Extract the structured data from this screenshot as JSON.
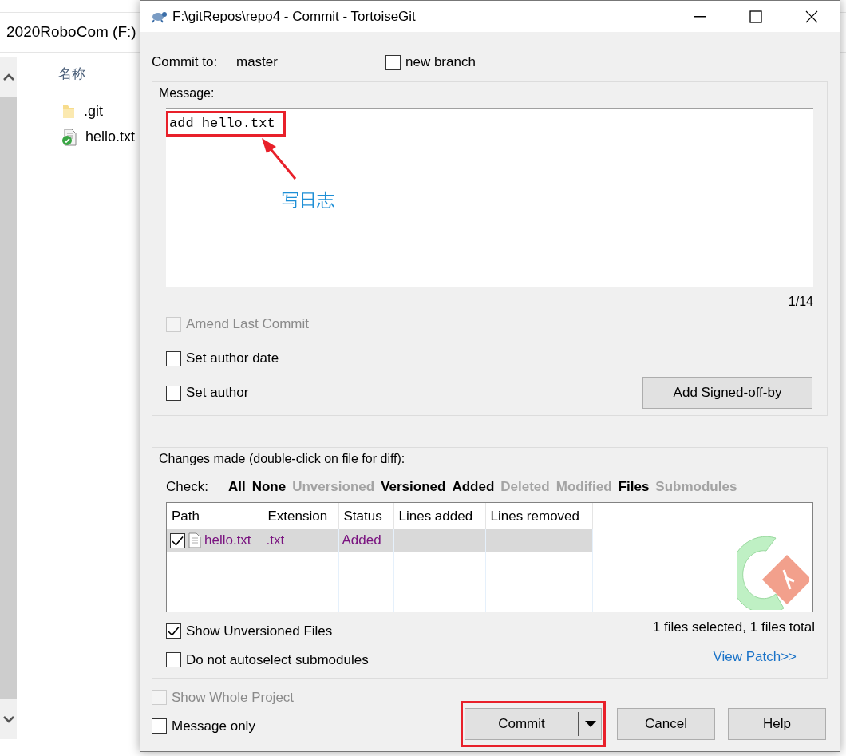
{
  "explorer": {
    "location": "2020RoboCom (F:)",
    "column_header": "名称",
    "files": [
      {
        "name": ".git",
        "kind": "folder"
      },
      {
        "name": "hello.txt",
        "kind": "file"
      }
    ]
  },
  "window": {
    "title": "F:\\gitRepos\\repo4 - Commit - TortoiseGit"
  },
  "commit_to": {
    "label": "Commit to:",
    "branch": "master"
  },
  "new_branch": {
    "label": "new branch",
    "checked": false
  },
  "message": {
    "label": "Message:",
    "value": "add hello.txt",
    "highlighted": true,
    "counter": "1/14"
  },
  "options": [
    {
      "label": "Amend Last Commit",
      "checked": false,
      "disabled": true
    },
    {
      "label": "Set author date",
      "checked": false,
      "disabled": false
    },
    {
      "label": "Set author",
      "checked": false,
      "disabled": false
    }
  ],
  "signoff_button": "Add Signed-off-by",
  "changes": {
    "label": "Changes made (double-click on file for diff):",
    "check_label": "Check:",
    "filters": [
      {
        "label": "All",
        "enabled": true
      },
      {
        "label": "None",
        "enabled": true
      },
      {
        "label": "Unversioned",
        "enabled": false
      },
      {
        "label": "Versioned",
        "enabled": true
      },
      {
        "label": "Added",
        "enabled": true
      },
      {
        "label": "Deleted",
        "enabled": false
      },
      {
        "label": "Modified",
        "enabled": false
      },
      {
        "label": "Files",
        "enabled": true
      },
      {
        "label": "Submodules",
        "enabled": false
      }
    ],
    "columns": [
      "Path",
      "Extension",
      "Status",
      "Lines added",
      "Lines removed"
    ],
    "rows": [
      {
        "checked": true,
        "selected": true,
        "path": "hello.txt",
        "extension": ".txt",
        "status": "Added"
      }
    ],
    "options": [
      {
        "label": "Show Unversioned Files",
        "checked": true,
        "disabled": false
      },
      {
        "label": "Do not autoselect submodules",
        "checked": false,
        "disabled": false
      }
    ],
    "summary": "1 files selected, 1 files total",
    "view_patch": "View Patch>>"
  },
  "bottom_options": [
    {
      "label": "Show Whole Project",
      "checked": false,
      "disabled": true
    },
    {
      "label": "Message only",
      "checked": false,
      "disabled": false
    }
  ],
  "buttons": [
    {
      "label": "Commit",
      "kind": "split",
      "highlighted": true
    },
    {
      "label": "Cancel",
      "kind": "plain",
      "highlighted": false
    },
    {
      "label": "Help",
      "kind": "plain",
      "highlighted": false
    }
  ],
  "annotation": {
    "note": "写日志"
  }
}
